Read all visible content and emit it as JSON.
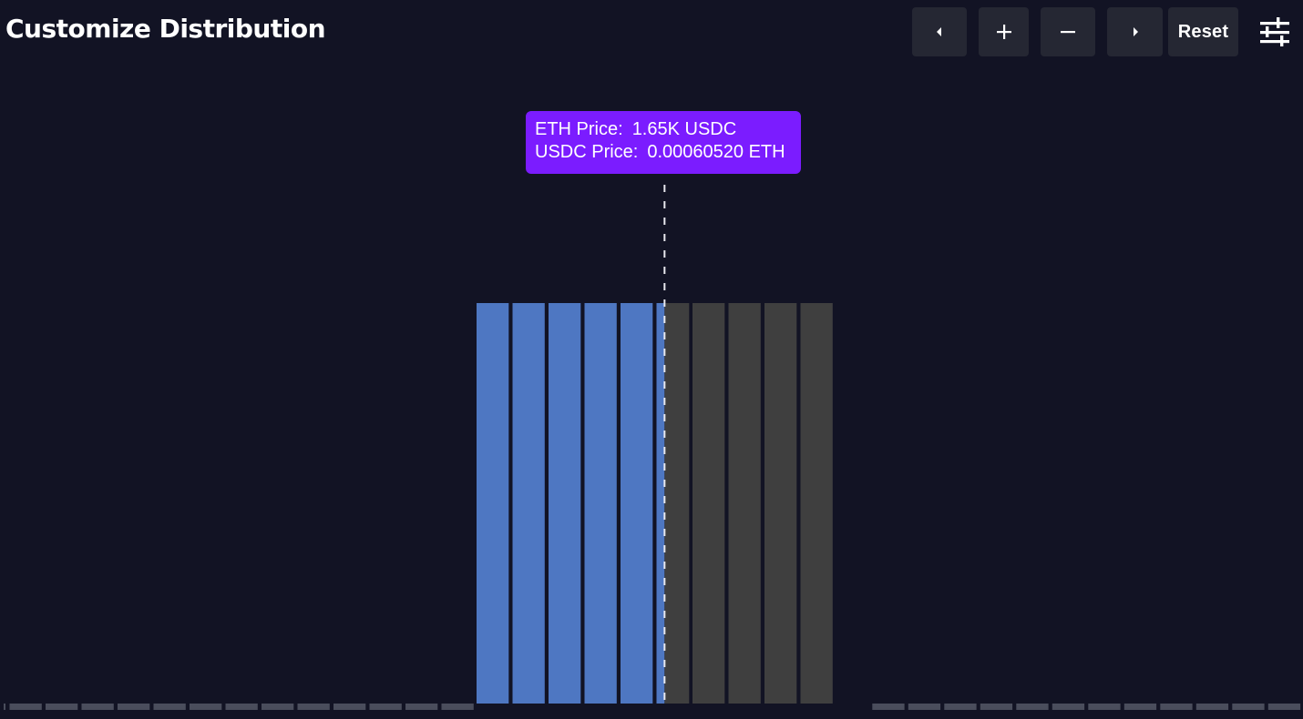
{
  "header": {
    "title": "Customize Distribution"
  },
  "toolbar": {
    "prev_icon": "caret-left-icon",
    "zoom_in_icon": "plus-icon",
    "zoom_out_icon": "minus-icon",
    "next_icon": "caret-right-icon",
    "reset_label": "Reset",
    "settings_icon": "sliders-icon"
  },
  "tooltip": {
    "eth_label": "ETH Price:",
    "eth_value": "1.65K USDC",
    "usdc_label": "USDC Price:",
    "usdc_value": "0.00060520 ETH"
  },
  "colors": {
    "background": "#121324",
    "accent": "#7b1cff",
    "bar_active": "#4e77c2",
    "bar_inactive": "#3f3f3f",
    "empty_bin": "#4a4d5c",
    "button": "#252733"
  },
  "chart_data": {
    "type": "bar",
    "description_bins": "liquidity distribution bins; empty bins shown as baseline dashes",
    "bins_left_empty": 13,
    "active_bins": [
      1,
      1,
      1,
      1,
      1,
      1
    ],
    "inactive_bins": [
      1,
      1,
      1,
      1,
      1
    ],
    "bins_right_empty": 12,
    "current_price_bin": 5,
    "current_price_offset": 0.25
  }
}
